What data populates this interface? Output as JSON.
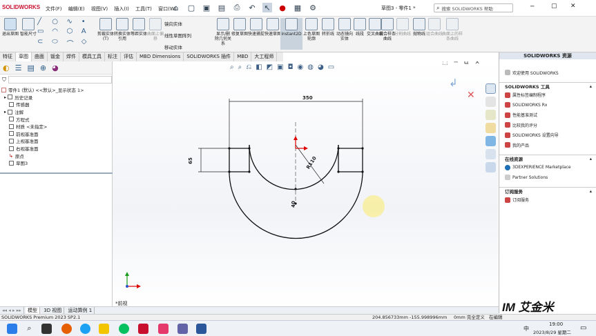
{
  "app": {
    "logo": "SOLIDWORKS",
    "window_title": "草图3 - 零件1 *"
  },
  "menu": [
    "文件(F)",
    "编辑(E)",
    "视图(V)",
    "插入(I)",
    "工具(T)",
    "窗口(W)"
  ],
  "search": {
    "placeholder": "搜索 SOLIDWORKS 帮助"
  },
  "ribbon": {
    "buttons": [
      {
        "label": "退出草图"
      },
      {
        "label": "智能尺寸"
      },
      {
        "label": "剪裁实体(T)"
      },
      {
        "label": "转换实体引用"
      },
      {
        "label": "等距实体"
      },
      {
        "label": "曲面上偏移"
      },
      {
        "label": "显示/删除几何关系"
      },
      {
        "label": "修复草图"
      },
      {
        "label": "快速捕捉"
      },
      {
        "label": "快速草图"
      },
      {
        "label": "Instant2D"
      },
      {
        "label": "上色草图轮廓"
      },
      {
        "label": "转折线"
      },
      {
        "label": "动态镜向实体"
      },
      {
        "label": "线段"
      },
      {
        "label": "交叉曲线"
      },
      {
        "label": "套合样条曲线"
      },
      {
        "label": "分割曲线"
      },
      {
        "label": "抛物线"
      },
      {
        "label": "组合曲线"
      },
      {
        "label": "曲面上的样条曲线"
      }
    ],
    "small": [
      "镜向实体",
      "线性草图阵列",
      "移动实体"
    ]
  },
  "command_tabs": [
    "特征",
    "草图",
    "曲面",
    "钣金",
    "焊件",
    "模具工具",
    "标注",
    "评估",
    "MBD Dimensions",
    "SOLIDWORKS 插件",
    "MBD",
    "大工程师"
  ],
  "active_tab": "草图",
  "tree": {
    "root": "零件1 (默认) <<默认>_显示状态 1>",
    "items": [
      "历史记录",
      "传感器",
      "注解",
      "方程式",
      "材质 <未指定>",
      "前视基准面",
      "上视基准面",
      "右视基准面",
      "原点",
      "草图3"
    ]
  },
  "sketch": {
    "dim_width": "350",
    "dim_height": "65",
    "dim_radius": "R110",
    "dim_bottom": "40",
    "view_label": "*前视"
  },
  "taskpane": {
    "title": "SOLIDWORKS 资源",
    "welcome": "欢迎使用 SOLIDWORKS",
    "tools_title": "SOLIDWORKS 工具",
    "tools": [
      "属性标签编制程序",
      "SOLIDWORKS Rx",
      "性能基准测试",
      "比较我的评分",
      "SOLIDWORKS 设置向导",
      "我的产品"
    ],
    "online_title": "在线资源",
    "online": [
      "3DEXPERIENCE Marketplace",
      "Partner Solutions"
    ],
    "sub_title": "订阅服务",
    "sub": [
      "订阅服务"
    ]
  },
  "bottom_tabs": [
    "模型",
    "3D 视图",
    "运动算例 1"
  ],
  "status": {
    "product": "SOLIDWORKS Premium 2023 SP2.1",
    "coords": "204.856733mm   -155.998996mm",
    "state": "0mm 完全定义",
    "editing": "在编辑"
  },
  "taskbar": {
    "time": "19:00",
    "date": "2023/8/29 星期二",
    "lang": "中"
  },
  "watermark": "IM 艾金米",
  "colors": {
    "accent": "#0b5cad",
    "taskpane_head": "#dfe6ef",
    "brand_red": "#c8102e"
  }
}
